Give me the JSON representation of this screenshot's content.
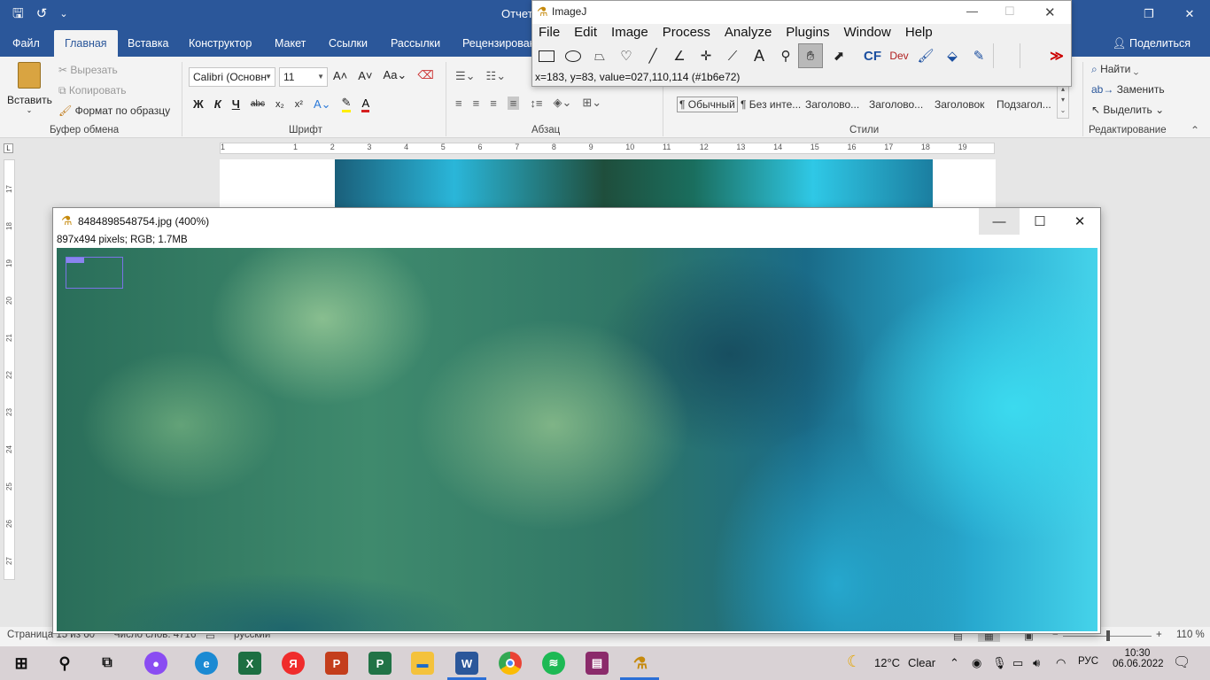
{
  "word": {
    "title": "Отчет",
    "tabs": [
      "Файл",
      "Главная",
      "Вставка",
      "Конструктор",
      "Макет",
      "Ссылки",
      "Рассылки",
      "Рецензирован"
    ],
    "active_tab": "Главная",
    "share": "Поделиться",
    "clipboard": {
      "paste": "Вставить",
      "cut": "Вырезать",
      "copy": "Копировать",
      "format_painter": "Формат по образцу",
      "label": "Буфер обмена"
    },
    "font": {
      "name": "Calibri (Основн",
      "size": "11",
      "label": "Шрифт",
      "bold": "Ж",
      "italic": "К",
      "underline": "Ч",
      "strike": "abc",
      "sub": "x₂",
      "sup": "x²"
    },
    "paragraph": {
      "label": "Абзац"
    },
    "styles": {
      "label": "Стили",
      "items": [
        "¶ Обычный",
        "¶ Без инте...",
        "Заголово...",
        "Заголово...",
        "Заголовок",
        "Подзагол..."
      ]
    },
    "editing": {
      "label": "Редактирование",
      "find": "Найти",
      "replace": "Заменить",
      "select": "Выделить"
    },
    "ruler_h_nums": [
      "1",
      "1",
      "2",
      "3",
      "4",
      "5",
      "6",
      "7",
      "8",
      "9",
      "10",
      "11",
      "12",
      "13",
      "14",
      "15",
      "16",
      "17",
      "18",
      "19"
    ],
    "ruler_v_nums": [
      "17",
      "18",
      "19",
      "20",
      "21",
      "22",
      "23",
      "24",
      "25",
      "26",
      "27"
    ],
    "status": {
      "page": "Страница 15 из 60",
      "words": "Число слов: 4716",
      "lang": "русский",
      "zoom": "110 %"
    }
  },
  "imagej": {
    "title": "ImageJ",
    "menu": [
      "File",
      "Edit",
      "Image",
      "Process",
      "Analyze",
      "Plugins",
      "Window",
      "Help"
    ],
    "tools": [
      "rectangle-tool",
      "oval-tool",
      "polygon-tool",
      "freehand-tool",
      "line-tool",
      "angle-tool",
      "point-tool",
      "wand-tool",
      "text-tool",
      "magnifier-tool",
      "hand-tool",
      "color-picker-tool",
      "cf-tool",
      "dev-tool",
      "brush-tool",
      "flood-fill-tool",
      "pencil-tool",
      "blank-tool-1",
      "blank-tool-2",
      "more-tools"
    ],
    "tool_labels": {
      "cf": "CF",
      "dev": "Dev",
      "text": "A",
      "more": "≫"
    },
    "selected_tool": "hand-tool",
    "status": "x=183, y=83, value=027,110,114 (#1b6e72)"
  },
  "image_window": {
    "title": "8484898548754.jpg (400%)",
    "info": "897x494 pixels; RGB; 1.7MB"
  },
  "taskbar": {
    "weather_temp": "12°C",
    "weather_text": "Clear",
    "lang": "РУС",
    "time": "10:30",
    "date": "06.06.2022",
    "apps": [
      "start",
      "search",
      "task-view",
      "alice",
      "edge",
      "excel",
      "yandex",
      "powerpoint",
      "project",
      "explorer",
      "word",
      "chrome",
      "spotify",
      "winrar",
      "imagej"
    ]
  },
  "colors": {
    "word_blue": "#2b579a",
    "ribbon_bg": "#f3f3f3",
    "taskbar_bg": "#d9d2d5"
  }
}
